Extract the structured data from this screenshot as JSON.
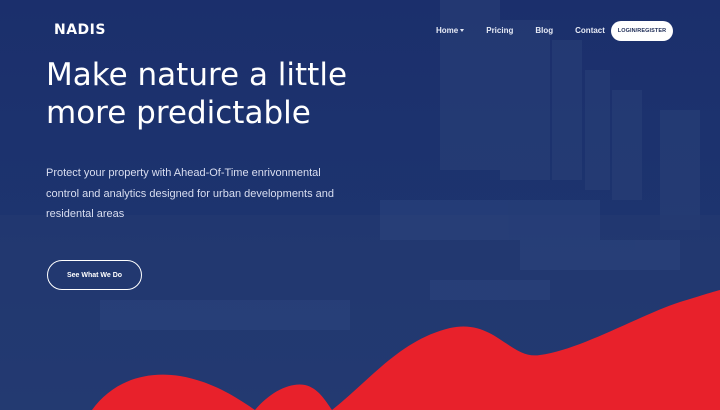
{
  "brand": {
    "logo_text": "NADIS"
  },
  "nav": {
    "items": [
      {
        "label": "Home",
        "has_dropdown": true
      },
      {
        "label": "Pricing",
        "has_dropdown": false
      },
      {
        "label": "Blog",
        "has_dropdown": false
      },
      {
        "label": "Contact",
        "has_dropdown": false
      }
    ],
    "login_label": "LOGIN/REGISTER"
  },
  "hero": {
    "headline": "Make nature a little more predictable",
    "subtext": "Protect your property with Ahead-Of-Time enrivonmental control and analytics designed for urban developments and residental areas",
    "cta_label": "See What We Do"
  },
  "colors": {
    "background": "#1c3271",
    "accent_wave": "#e8212b",
    "text": "#ffffff"
  }
}
